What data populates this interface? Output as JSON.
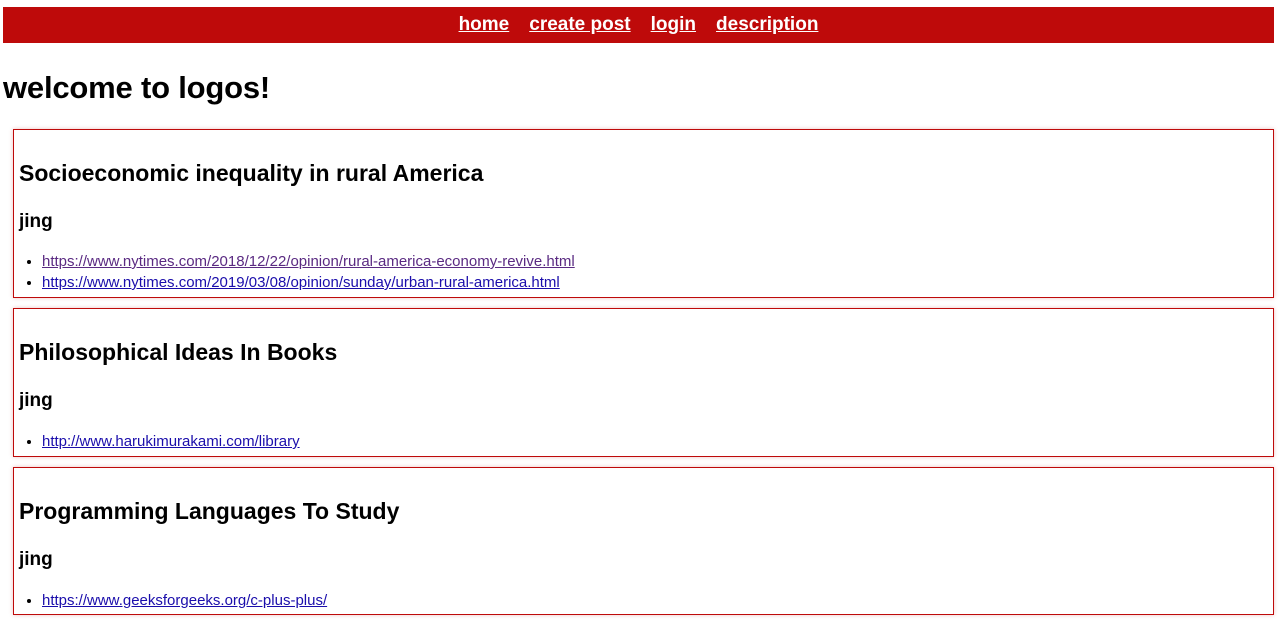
{
  "nav": {
    "items": [
      {
        "label": "home"
      },
      {
        "label": "create post"
      },
      {
        "label": "login"
      },
      {
        "label": "description"
      }
    ]
  },
  "page": {
    "title": "welcome to logos!"
  },
  "posts": [
    {
      "title": "Socioeconomic inequality in rural America",
      "author": "jing",
      "links": [
        "https://www.nytimes.com/2018/12/22/opinion/rural-america-economy-revive.html",
        "https://www.nytimes.com/2019/03/08/opinion/sunday/urban-rural-america.html"
      ]
    },
    {
      "title": "Philosophical Ideas In Books",
      "author": "jing",
      "links": [
        "http://www.harukimurakami.com/library"
      ]
    },
    {
      "title": "Programming Languages To Study",
      "author": "jing",
      "links": [
        "https://www.geeksforgeeks.org/c-plus-plus/"
      ]
    }
  ],
  "colors": {
    "brand": "#be0a0a",
    "link": "#1a0dab",
    "visited_link": "#5a2a82"
  }
}
